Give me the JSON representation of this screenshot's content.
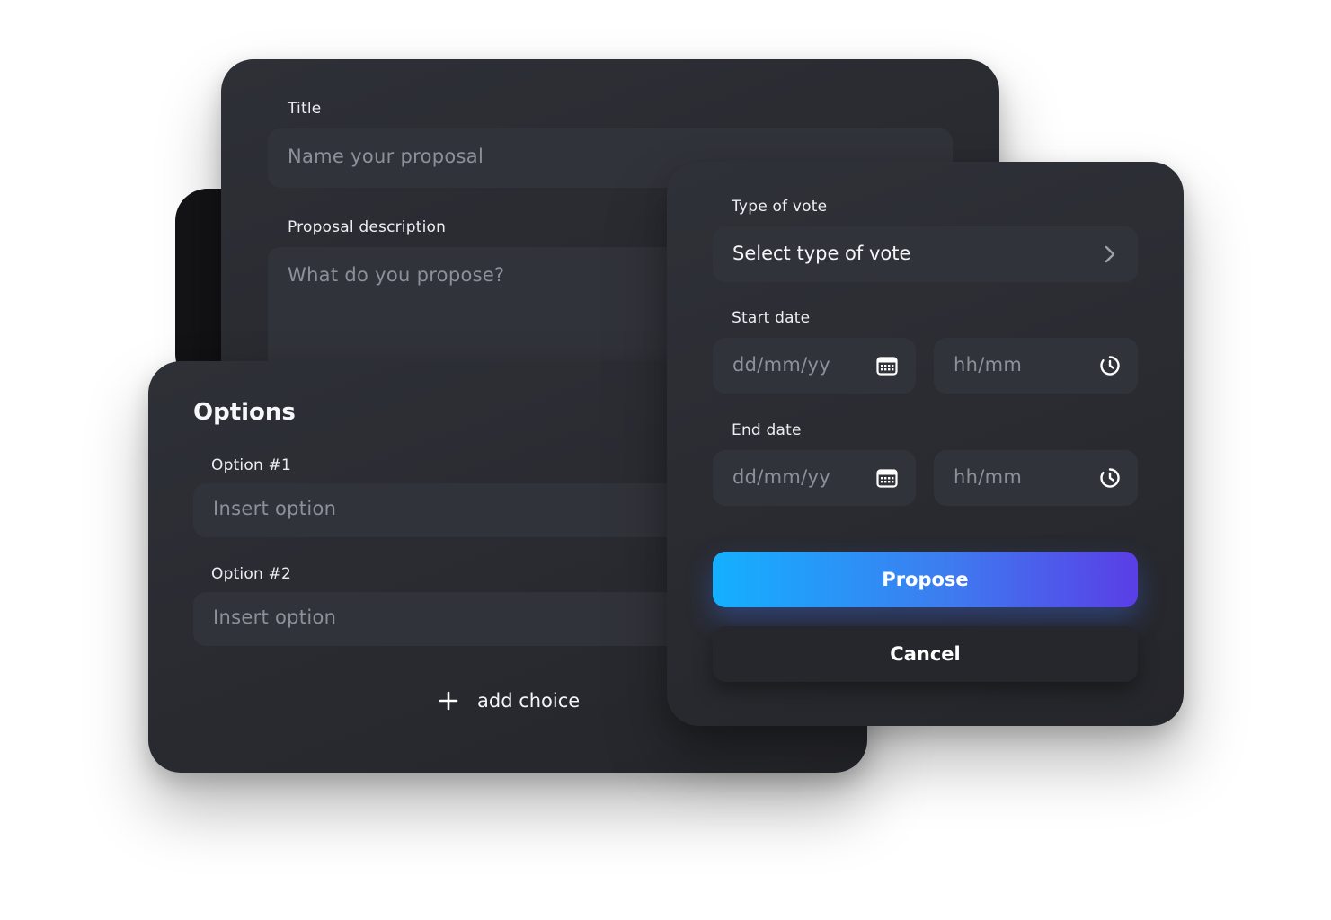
{
  "proposal_card": {
    "title_label": "Title",
    "title_placeholder": "Name your proposal",
    "description_label": "Proposal description",
    "description_placeholder": "What do you propose?"
  },
  "options_card": {
    "heading": "Options",
    "options": [
      {
        "label": "Option #1",
        "placeholder": "Insert option"
      },
      {
        "label": "Option #2",
        "placeholder": "Insert option"
      }
    ],
    "add_choice_label": "add choice"
  },
  "vote_card": {
    "type_label": "Type of vote",
    "type_value": "Select type of vote",
    "start_label": "Start date",
    "start_date_placeholder": "dd/mm/yy",
    "start_time_placeholder": "hh/mm",
    "end_label": "End date",
    "end_date_placeholder": "dd/mm/yy",
    "end_time_placeholder": "hh/mm",
    "propose_label": "Propose",
    "cancel_label": "Cancel"
  },
  "icons": {
    "chevron": "chevron-right-icon",
    "calendar": "calendar-icon",
    "clock": "clock-icon",
    "plus": "plus-icon"
  },
  "colors": {
    "card_bg": "#2a2c32",
    "field_bg": "#31333a",
    "accent_start": "#14b0ff",
    "accent_end": "#5a3ee6"
  }
}
